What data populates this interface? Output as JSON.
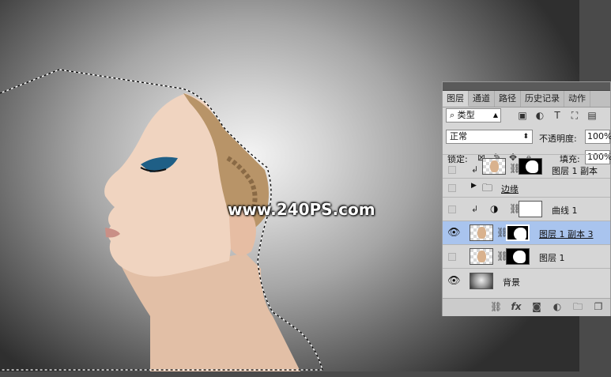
{
  "watermark": "www.240PS.com",
  "panel": {
    "tabs": [
      {
        "label": "图层",
        "active": true
      },
      {
        "label": "通道",
        "active": false
      },
      {
        "label": "路径",
        "active": false
      },
      {
        "label": "历史记录",
        "active": false
      },
      {
        "label": "动作",
        "active": false
      }
    ],
    "filter": {
      "search_glyph": "⌕",
      "value": "类型"
    },
    "blend_mode": "正常",
    "opacity_label": "不透明度:",
    "opacity_value": "100%",
    "lock_label": "锁定:",
    "fill_label": "填充:",
    "fill_value": "100%",
    "layers": [
      {
        "name": "图层 1 副本",
        "visible": false,
        "clipped": true,
        "selected": false,
        "kind": "masked"
      },
      {
        "name": "边缘",
        "visible": false,
        "clipped": false,
        "selected": false,
        "kind": "group"
      },
      {
        "name": "曲线 1",
        "visible": false,
        "clipped": true,
        "selected": false,
        "kind": "adjustment"
      },
      {
        "name": "图层 1 副本 3",
        "visible": true,
        "clipped": false,
        "selected": true,
        "kind": "masked"
      },
      {
        "name": "图层 1",
        "visible": false,
        "clipped": false,
        "selected": false,
        "kind": "masked"
      },
      {
        "name": "背景",
        "visible": true,
        "clipped": false,
        "selected": false,
        "kind": "background"
      }
    ],
    "bottom_fx_label": "fx"
  },
  "colors": {
    "selection": "#a9c4ee",
    "panel_bg": "#d6d6d6"
  }
}
